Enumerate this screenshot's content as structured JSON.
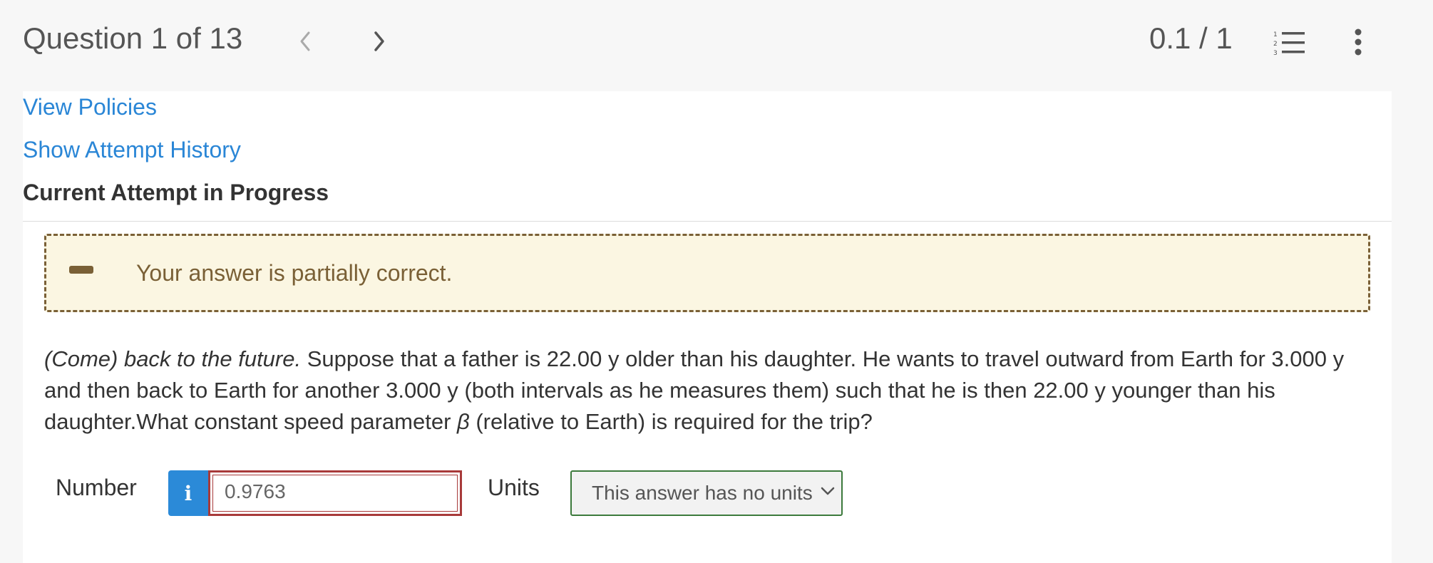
{
  "header": {
    "question_title": "Question 1 of 13",
    "score": "0.1 / 1"
  },
  "links": {
    "view_policies": "View Policies",
    "show_attempt_history": "Show Attempt History"
  },
  "attempt_label": "Current Attempt in Progress",
  "feedback": {
    "text": "Your answer is partially correct."
  },
  "question": {
    "title_italic": "(Come) back to the future.",
    "body_before_beta": " Suppose that a father is 22.00 y older than his daughter. He wants to travel outward from Earth for 3.000 y and then back to Earth for another 3.000 y (both intervals as he measures them) such that he is then 22.00 y younger than his daughter.What constant speed parameter ",
    "beta_symbol": "β",
    "body_after_beta": " (relative to Earth) is required for the trip?"
  },
  "answer": {
    "number_label": "Number",
    "info_glyph": "i",
    "number_value": "0.9763",
    "units_label": "Units",
    "units_selected": "This answer has no units"
  },
  "colors": {
    "link": "#2a86d6",
    "feedback_border": "#7a6036",
    "feedback_bg": "#fbf6e2",
    "input_error_border": "#a83a3a",
    "select_border": "#3c7a3c",
    "info_button": "#2b8ad8"
  },
  "icons": [
    "chevron-left-icon",
    "chevron-right-icon",
    "numbered-list-icon",
    "more-vertical-icon",
    "partial-correct-dash-icon",
    "info-icon",
    "chevron-down-icon"
  ]
}
